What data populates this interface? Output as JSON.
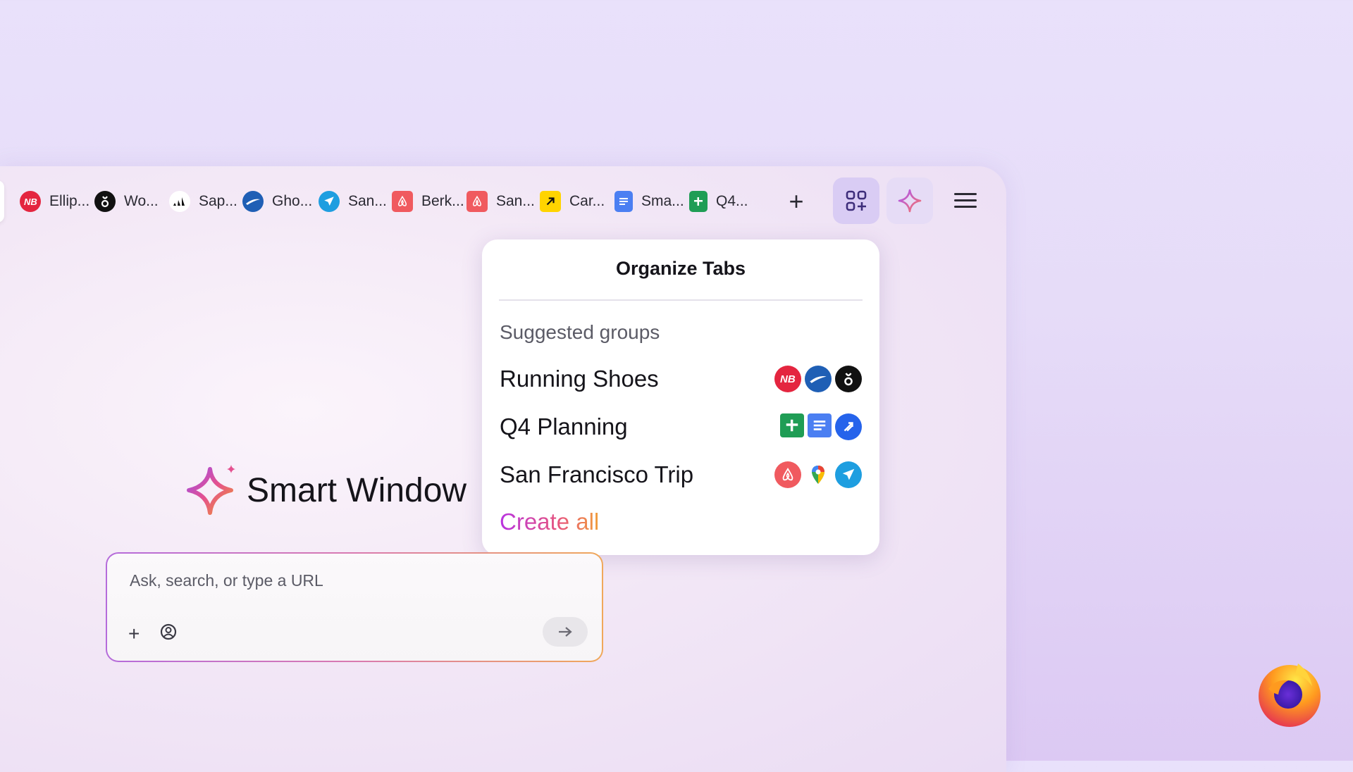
{
  "tabs": [
    {
      "label": "Ellip...",
      "icon": "new-balance-icon",
      "color": "#e4253f"
    },
    {
      "label": "Wo...",
      "icon": "on-running-icon",
      "color": "#111111"
    },
    {
      "label": "Sap...",
      "icon": "adidas-icon",
      "color": "#ffffff"
    },
    {
      "label": "Gho...",
      "icon": "brooks-icon",
      "color": "#1f5fb5"
    },
    {
      "label": "San...",
      "icon": "airplane-icon",
      "color": "#1e9ee0"
    },
    {
      "label": "Berk...",
      "icon": "airbnb-icon",
      "color": "#f05a5f"
    },
    {
      "label": "San...",
      "icon": "airbnb-icon",
      "color": "#f05a5f"
    },
    {
      "label": "Car...",
      "icon": "arrow-diagonal-icon",
      "color": "#ffd400"
    },
    {
      "label": "Sma...",
      "icon": "docs-icon",
      "color": "#4b7ff2"
    },
    {
      "label": "Q4...",
      "icon": "sheets-icon",
      "color": "#1f9d55"
    }
  ],
  "toolbar": {
    "newtab": "+"
  },
  "panel": {
    "title": "Organize Tabs",
    "subtitle": "Suggested groups",
    "groups": [
      {
        "label": "Running Shoes"
      },
      {
        "label": "Q4 Planning"
      },
      {
        "label": "San Francisco Trip"
      }
    ],
    "create_all": "Create all"
  },
  "brand": {
    "title": "Smart Window"
  },
  "search": {
    "placeholder": "Ask, search, or type a URL",
    "plus": "+"
  }
}
